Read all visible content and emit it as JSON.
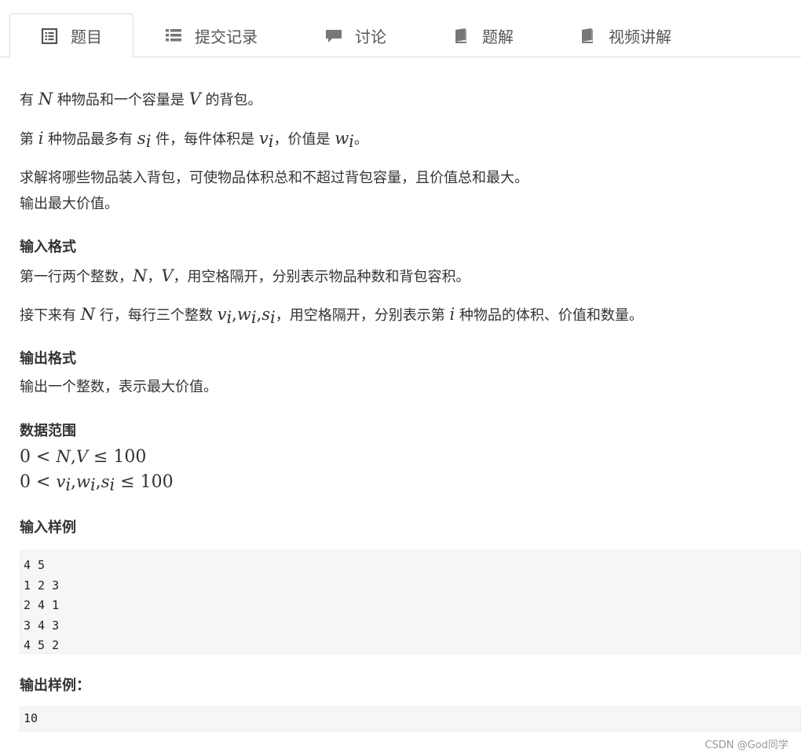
{
  "tabs": [
    {
      "label": "题目",
      "icon": "document-list-icon",
      "active": true
    },
    {
      "label": "提交记录",
      "icon": "list-icon",
      "active": false
    },
    {
      "label": "讨论",
      "icon": "comment-icon",
      "active": false
    },
    {
      "label": "题解",
      "icon": "book-icon",
      "active": false
    },
    {
      "label": "视频讲解",
      "icon": "book-icon",
      "active": false
    }
  ],
  "problem": {
    "line1": {
      "a": "有 ",
      "N": "N",
      "b": " 种物品和一个容量是 ",
      "V": "V",
      "c": " 的背包。"
    },
    "line2": {
      "a": "第 ",
      "i": "i",
      "b": " 种物品最多有 ",
      "s": "s",
      "sub": "i",
      "c": " 件，每件体积是 ",
      "v": "v",
      "d": "，价值是 ",
      "w": "w",
      "e": "。"
    },
    "line3": "求解将哪些物品装入背包，可使物品体积总和不超过背包容量，且价值总和最大。",
    "line4": "输出最大价值。",
    "input_heading": "输入格式",
    "input_line1": {
      "a": "第一行两个整数，",
      "N": "N",
      "sep": "，",
      "V": "V",
      "b": "，用空格隔开，分别表示物品种数和背包容积。"
    },
    "input_line2": {
      "a": "接下来有 ",
      "N": "N",
      "b": " 行，每行三个整数 ",
      "v": "v",
      "w": "w",
      "s": "s",
      "sub": "i",
      "comma": ",",
      "c": "，用空格隔开，分别表示第 ",
      "i": "i",
      "d": " 种物品的体积、价值和数量。"
    },
    "output_heading": "输出格式",
    "output_line": "输出一个整数，表示最大价值。",
    "range_heading": "数据范围",
    "range1": {
      "zero": "0",
      "lt": "<",
      "N": "N",
      "comma": ",",
      "V": "V",
      "le": "≤",
      "max": "100"
    },
    "range2": {
      "zero": "0",
      "lt": "<",
      "v": "v",
      "w": "w",
      "s": "s",
      "sub": "i",
      "comma": ",",
      "le": "≤",
      "max": "100"
    },
    "sample_input_heading": "输入样例",
    "sample_input": [
      "4 5",
      "1 2 3",
      "2 4 1",
      "3 4 3",
      "4 5 2"
    ],
    "sample_output_heading": "输出样例：",
    "sample_output": [
      "10"
    ]
  },
  "watermark": "CSDN @God同学"
}
